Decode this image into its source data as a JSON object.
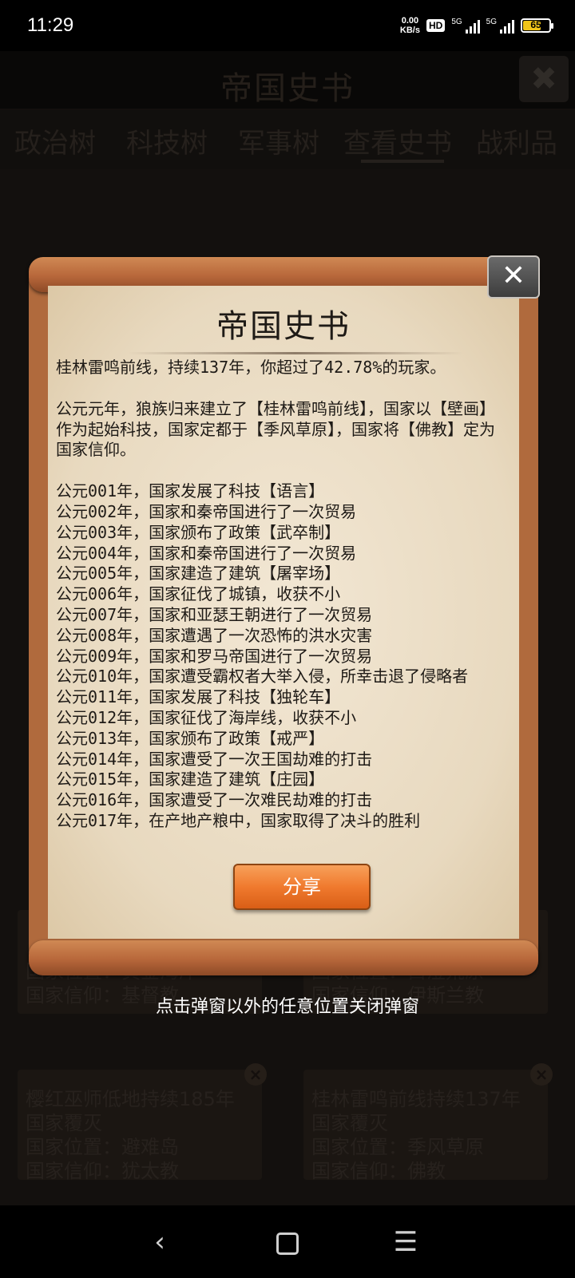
{
  "status_bar": {
    "time": "11:29",
    "net_speed_value": "0.00",
    "net_speed_unit": "KB/s",
    "hd_badge": "HD",
    "signal1_label": "5G",
    "signal2_label": "5G",
    "battery_level": "65",
    "battery_fraction": 0.65,
    "battery_color": "#f0c419"
  },
  "background_page": {
    "title": "帝国史书",
    "close_icon": "close-icon",
    "tabs": [
      {
        "label": "政治树"
      },
      {
        "label": "科技树"
      },
      {
        "label": "军事树"
      },
      {
        "label": "查看史书",
        "selected": true
      },
      {
        "label": "战利品"
      }
    ],
    "cards_bottom": [
      {
        "text": "樱红巫师低地持续185年\n国家覆灭\n国家位置：避难岛\n国家信仰：犹太教"
      },
      {
        "text": "桂林雷鸣前线持续137年\n国家覆灭\n国家位置：季风草原\n国家信仰：佛教"
      }
    ],
    "cards_partial": [
      {
        "text": "国家位置：黄金海岸\n国家信仰：基督教"
      },
      {
        "text": "国家位置：白澄荒原\n国家信仰：伊斯兰教"
      }
    ]
  },
  "dialog": {
    "title": "帝国史书",
    "close_icon": "close-icon",
    "summary": "桂林雷鸣前线，持续137年，你超过了42.78%的玩家。",
    "founding": "公元元年，狼族归来建立了【桂林雷鸣前线】，国家以【壁画】作为起始科技，国家定都于【季风草原】，国家将【佛教】定为国家信仰。",
    "events": [
      "公元001年，国家发展了科技【语言】",
      "公元002年，国家和秦帝国进行了一次贸易",
      "公元003年，国家颁布了政策【武卒制】",
      "公元004年，国家和秦帝国进行了一次贸易",
      "公元005年，国家建造了建筑【屠宰场】",
      "公元006年，国家征伐了城镇，收获不小",
      "公元007年，国家和亚瑟王朝进行了一次贸易",
      "公元008年，国家遭遇了一次恐怖的洪水灾害",
      "公元009年，国家和罗马帝国进行了一次贸易",
      "公元010年，国家遭受霸权者大举入侵，所幸击退了侵略者",
      "公元011年，国家发展了科技【独轮车】",
      "公元012年，国家征伐了海岸线，收获不小",
      "公元013年，国家颁布了政策【戒严】",
      "公元014年，国家遭受了一次王国劫难的打击",
      "公元015年，国家建造了建筑【庄园】",
      "公元016年，国家遭受了一次难民劫难的打击",
      "公元017年，在产地产粮中，国家取得了决斗的胜利"
    ],
    "share_label": "分享"
  },
  "hint": "点击弹窗以外的任意位置关闭弹窗",
  "nav": {
    "back_icon": "back-icon",
    "home_icon": "home-icon",
    "menu_icon": "menu-icon"
  }
}
